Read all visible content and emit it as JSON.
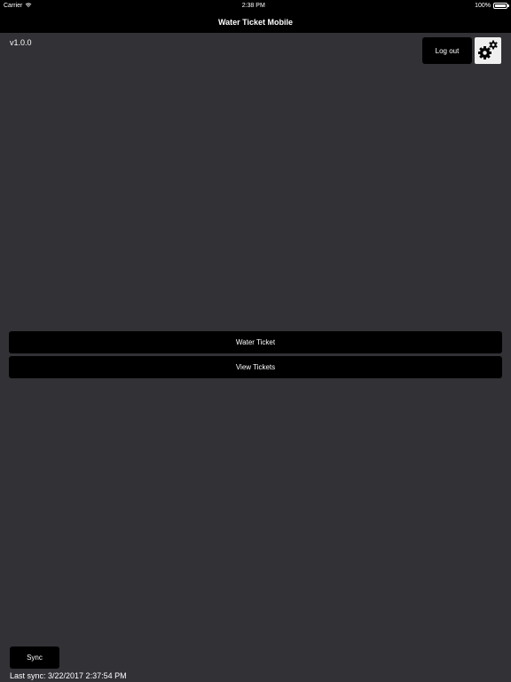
{
  "status_bar": {
    "carrier": "Carrier",
    "time": "2:38 PM",
    "battery_percent": "100%",
    "battery_level": 1.0
  },
  "nav_bar": {
    "title": "Water Ticket Mobile"
  },
  "header": {
    "version": "v1.0.0",
    "logout_label": "Log out",
    "settings_icon": "gear-icon"
  },
  "main": {
    "water_ticket_label": "Water Ticket",
    "view_tickets_label": "View Tickets"
  },
  "footer": {
    "sync_label": "Sync",
    "last_sync_text": "Last sync: 3/22/2017 2:37:54 PM"
  },
  "colors": {
    "background": "#323136",
    "bar": "#000000",
    "text": "#ffffff"
  }
}
